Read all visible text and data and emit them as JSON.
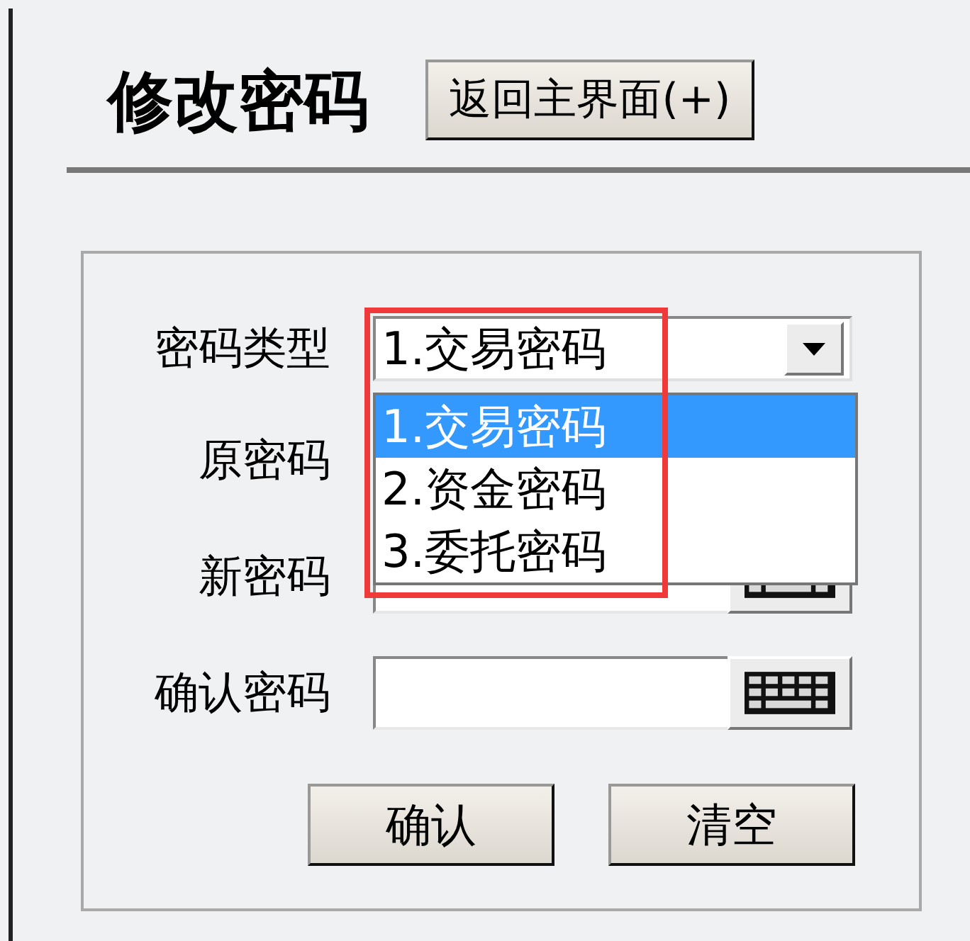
{
  "title": "修改密码",
  "back_button": "返回主界面(+)",
  "form": {
    "rows": [
      {
        "label": "密码类型",
        "kind": "select",
        "value": "1.交易密码",
        "expanded": true,
        "highlighted": true,
        "options": [
          {
            "label": "1.交易密码",
            "selected": true
          },
          {
            "label": "2.资金密码",
            "selected": false
          },
          {
            "label": "3.委托密码",
            "selected": false
          }
        ]
      },
      {
        "label": "原密码",
        "kind": "covered"
      },
      {
        "label": "新密码",
        "kind": "password"
      },
      {
        "label": "确认密码",
        "kind": "password"
      }
    ]
  },
  "buttons": [
    "确认",
    "清空"
  ]
}
